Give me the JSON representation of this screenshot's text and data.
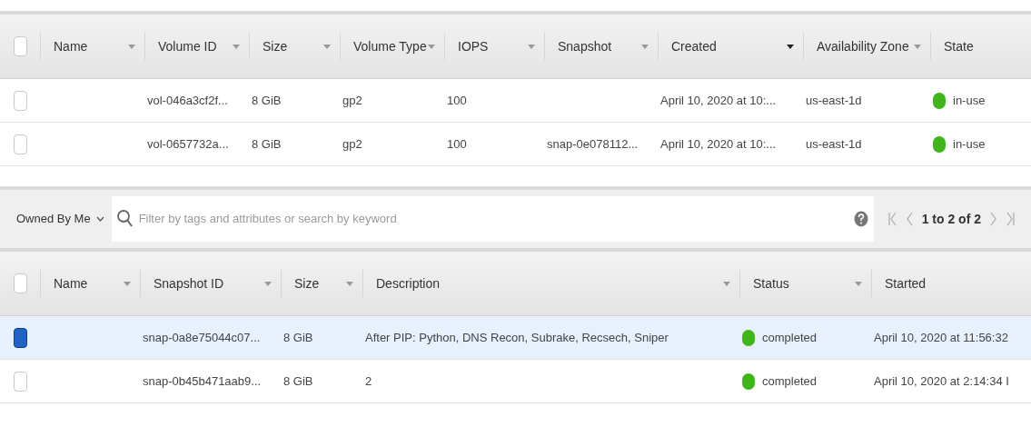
{
  "volumes": {
    "all_selected": false,
    "columns": [
      {
        "label": "Name",
        "sortable": true,
        "sorted": false
      },
      {
        "label": "Volume ID",
        "sortable": true,
        "sorted": false
      },
      {
        "label": "Size",
        "sortable": true,
        "sorted": false
      },
      {
        "label": "Volume Type",
        "sortable": true,
        "sorted": false
      },
      {
        "label": "IOPS",
        "sortable": true,
        "sorted": false
      },
      {
        "label": "Snapshot",
        "sortable": true,
        "sorted": false
      },
      {
        "label": "Created",
        "sortable": true,
        "sorted": true
      },
      {
        "label": "Availability Zone",
        "sortable": true,
        "sorted": false
      },
      {
        "label": "State",
        "sortable": false
      }
    ],
    "rows": [
      {
        "selected": false,
        "cells": [
          "",
          "vol-046a3cf2f...",
          "8 GiB",
          "gp2",
          "100",
          "",
          "April 10, 2020 at 10:...",
          "us-east-1d"
        ],
        "state": "in-use",
        "color": "#3fb618"
      },
      {
        "selected": false,
        "cells": [
          "",
          "vol-0657732a...",
          "8 GiB",
          "gp2",
          "100",
          "snap-0e078112...",
          "April 10, 2020 at 10:...",
          "us-east-1d"
        ],
        "state": "in-use",
        "color": "#3fb618"
      }
    ]
  },
  "filter": {
    "owner": "Owned By Me",
    "placeholder": "Filter by tags and attributes or search by keyword",
    "pagination": "1 to 2 of 2"
  },
  "snapshots": {
    "all_selected": false,
    "columns": [
      {
        "label": "Name",
        "sortable": true,
        "sorted": false
      },
      {
        "label": "Snapshot ID",
        "sortable": true,
        "sorted": false
      },
      {
        "label": "Size",
        "sortable": true,
        "sorted": false
      },
      {
        "label": "Description",
        "sortable": true,
        "sorted": false
      },
      {
        "label": "Status",
        "sortable": true,
        "sorted": false
      },
      {
        "label": "Started",
        "sortable": false
      }
    ],
    "rows": [
      {
        "selected": true,
        "cells": [
          "",
          "snap-0a8e75044c07...",
          "8 GiB",
          "After PIP: Python, DNS Recon, Subrake, Recsech, Sniper"
        ],
        "status": "completed",
        "color": "#3fb618",
        "started": "April 10, 2020 at 11:56:32"
      },
      {
        "selected": false,
        "cells": [
          "",
          "snap-0b45b471aab9...",
          "8 GiB",
          "2"
        ],
        "status": "completed",
        "color": "#3fb618",
        "started": "April 10, 2020 at 2:14:34 I"
      }
    ]
  }
}
